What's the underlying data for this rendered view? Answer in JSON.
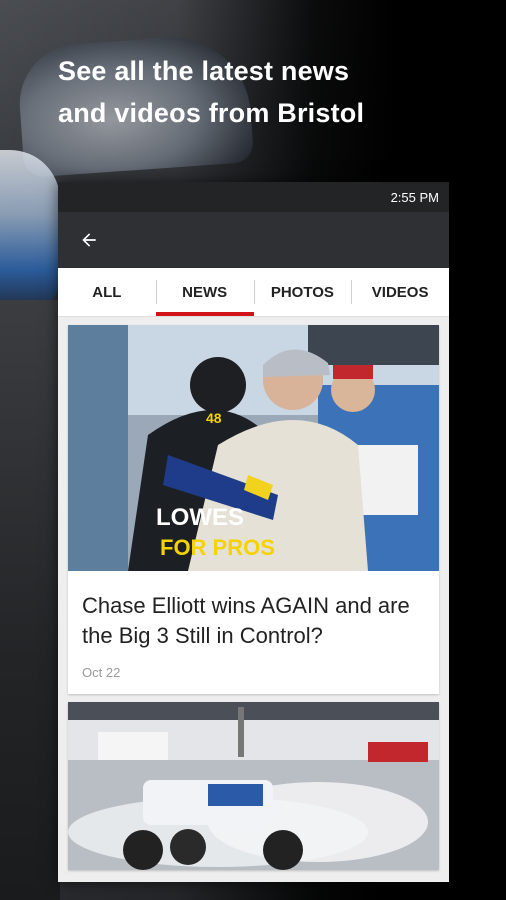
{
  "promo": {
    "headline_line1": "See all the latest news",
    "headline_line2": "and videos from Bristol"
  },
  "status_bar": {
    "time": "2:55 PM"
  },
  "app_bar": {
    "back_icon": "arrow-left-icon"
  },
  "tabs": [
    {
      "label": "ALL",
      "active": false
    },
    {
      "label": "NEWS",
      "active": true
    },
    {
      "label": "PHOTOS",
      "active": false
    },
    {
      "label": "VIDEOS",
      "active": false
    }
  ],
  "feed": [
    {
      "title": "Chase Elliott wins AGAIN and are the Big 3 Still in Control?",
      "date": "Oct 22",
      "image_text": {
        "car_number": "48",
        "sponsor_line1": "LOWES",
        "sponsor_line2": "FOR PROS"
      }
    },
    {
      "title": "",
      "date": "",
      "image_text": {}
    }
  ],
  "colors": {
    "accent": "#d0141a",
    "app_bar": "#2e3034",
    "status_bar": "#222426"
  }
}
